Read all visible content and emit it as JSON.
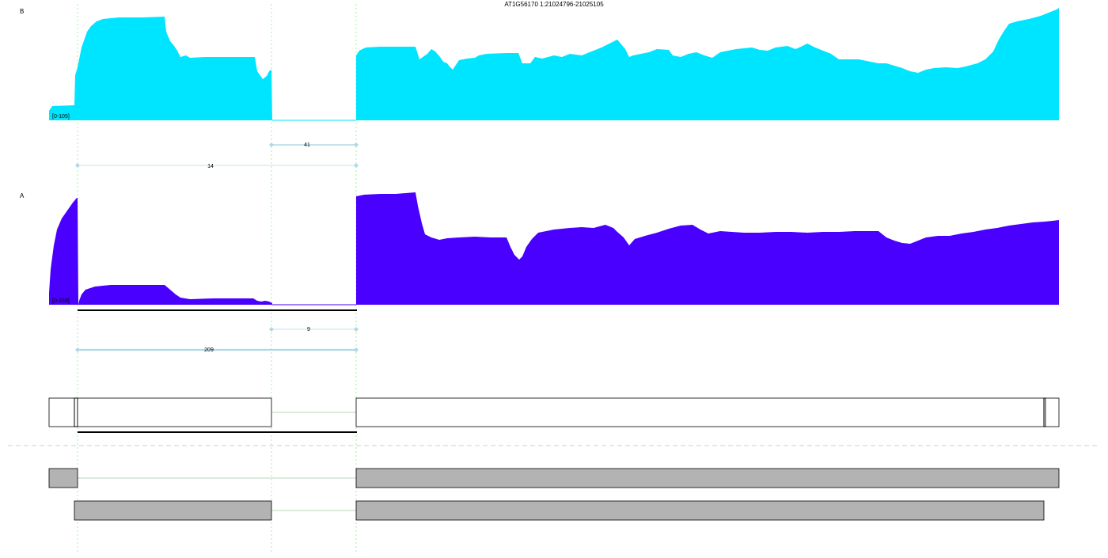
{
  "title": "AT1G56170 1:21024796-21025105",
  "tracks": [
    {
      "id": "B",
      "label": "B",
      "range_label": "[0-105]",
      "color": "#00e5ff",
      "junctions": [
        {
          "label": "41"
        },
        {
          "label": "14"
        }
      ]
    },
    {
      "id": "A",
      "label": "A",
      "range_label": "[0-238]",
      "color": "#4a00ff",
      "junctions": [
        {
          "label": "9"
        },
        {
          "label": "209"
        }
      ]
    }
  ],
  "colors": {
    "junction_line": "#add8e6",
    "guide_line": "#90ee90",
    "transcript_fill": "#b3b3b3",
    "gene_model_stroke": "#000000",
    "separator": "#c8d4d4"
  }
}
